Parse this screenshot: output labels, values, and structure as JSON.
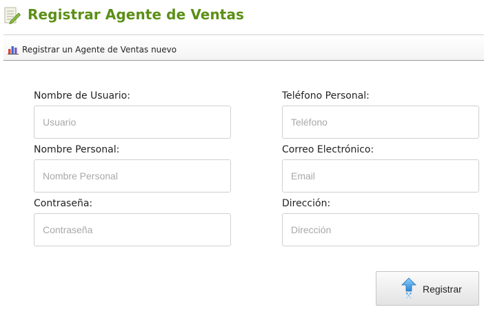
{
  "header": {
    "icon": "notepad-pencil-icon",
    "title": "Registrar Agente de Ventas"
  },
  "toolbar": {
    "icon": "bar-chart-icon",
    "label": "Registrar un Agente de Ventas nuevo"
  },
  "form": {
    "username": {
      "label": "Nombre de Usuario:",
      "placeholder": "Usuario",
      "value": ""
    },
    "personal_name": {
      "label": "Nombre Personal:",
      "placeholder": "Nombre Personal",
      "value": ""
    },
    "password": {
      "label": "Contraseña:",
      "placeholder": "Contraseña",
      "value": ""
    },
    "phone": {
      "label": "Teléfono Personal:",
      "placeholder": "Teléfono",
      "value": ""
    },
    "email": {
      "label": "Correo Electrónico:",
      "placeholder": "Email",
      "value": ""
    },
    "address": {
      "label": "Dirección:",
      "placeholder": "Dirección",
      "value": ""
    }
  },
  "submit": {
    "icon": "upload-arrow-icon",
    "label": "Registrar"
  },
  "colors": {
    "title_green": "#5b8f16",
    "input_border": "#cfcfcf",
    "placeholder_gray": "#a8a8a8"
  }
}
